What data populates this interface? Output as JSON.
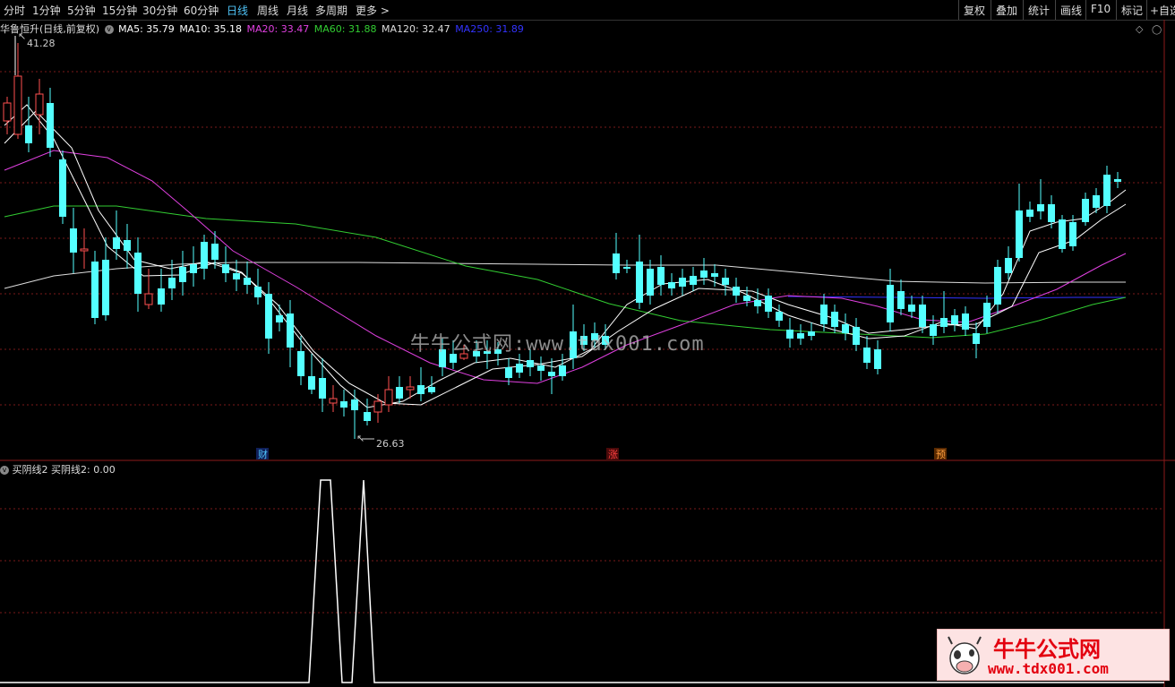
{
  "toolbar": {
    "periods": [
      "分时",
      "1分钟",
      "5分钟",
      "15分钟",
      "30分钟",
      "60分钟",
      "日线",
      "周线",
      "月线",
      "多周期",
      "更多"
    ],
    "active_period": "日线",
    "right_buttons": [
      "复权",
      "叠加",
      "统计",
      "画线",
      "F10",
      "标记",
      "+自选"
    ]
  },
  "stock": {
    "title": "华鲁恒升(日线,前复权)"
  },
  "ma_legend": [
    {
      "label": "MA5: 35.79",
      "color": "#ffffff"
    },
    {
      "label": "MA10: 35.18",
      "color": "#ffffff"
    },
    {
      "label": "MA20: 33.47",
      "color": "#e040e0"
    },
    {
      "label": "MA60: 31.88",
      "color": "#32cd32"
    },
    {
      "label": "MA120: 32.47",
      "color": "#dddddd"
    },
    {
      "label": "MA250: 31.89",
      "color": "#3333ff"
    }
  ],
  "price_annotations": {
    "high": "41.28",
    "low": "26.63"
  },
  "event_markers": [
    {
      "label": "财",
      "color": "#4fc3f7"
    },
    {
      "label": "涨",
      "color": "#ff4040"
    },
    {
      "label": "预",
      "color": "#ffa040"
    }
  ],
  "indicator": {
    "title": "买阴线2",
    "value_label": "买阴线2: 0.00"
  },
  "watermark": "牛牛公式网:www.tdx001.com",
  "corner_logo": {
    "name": "牛牛公式网",
    "url": "www.tdx001.com"
  },
  "colors": {
    "up": "#ff5050",
    "down": "#54ffff",
    "grid": "#7a1a1a"
  }
}
